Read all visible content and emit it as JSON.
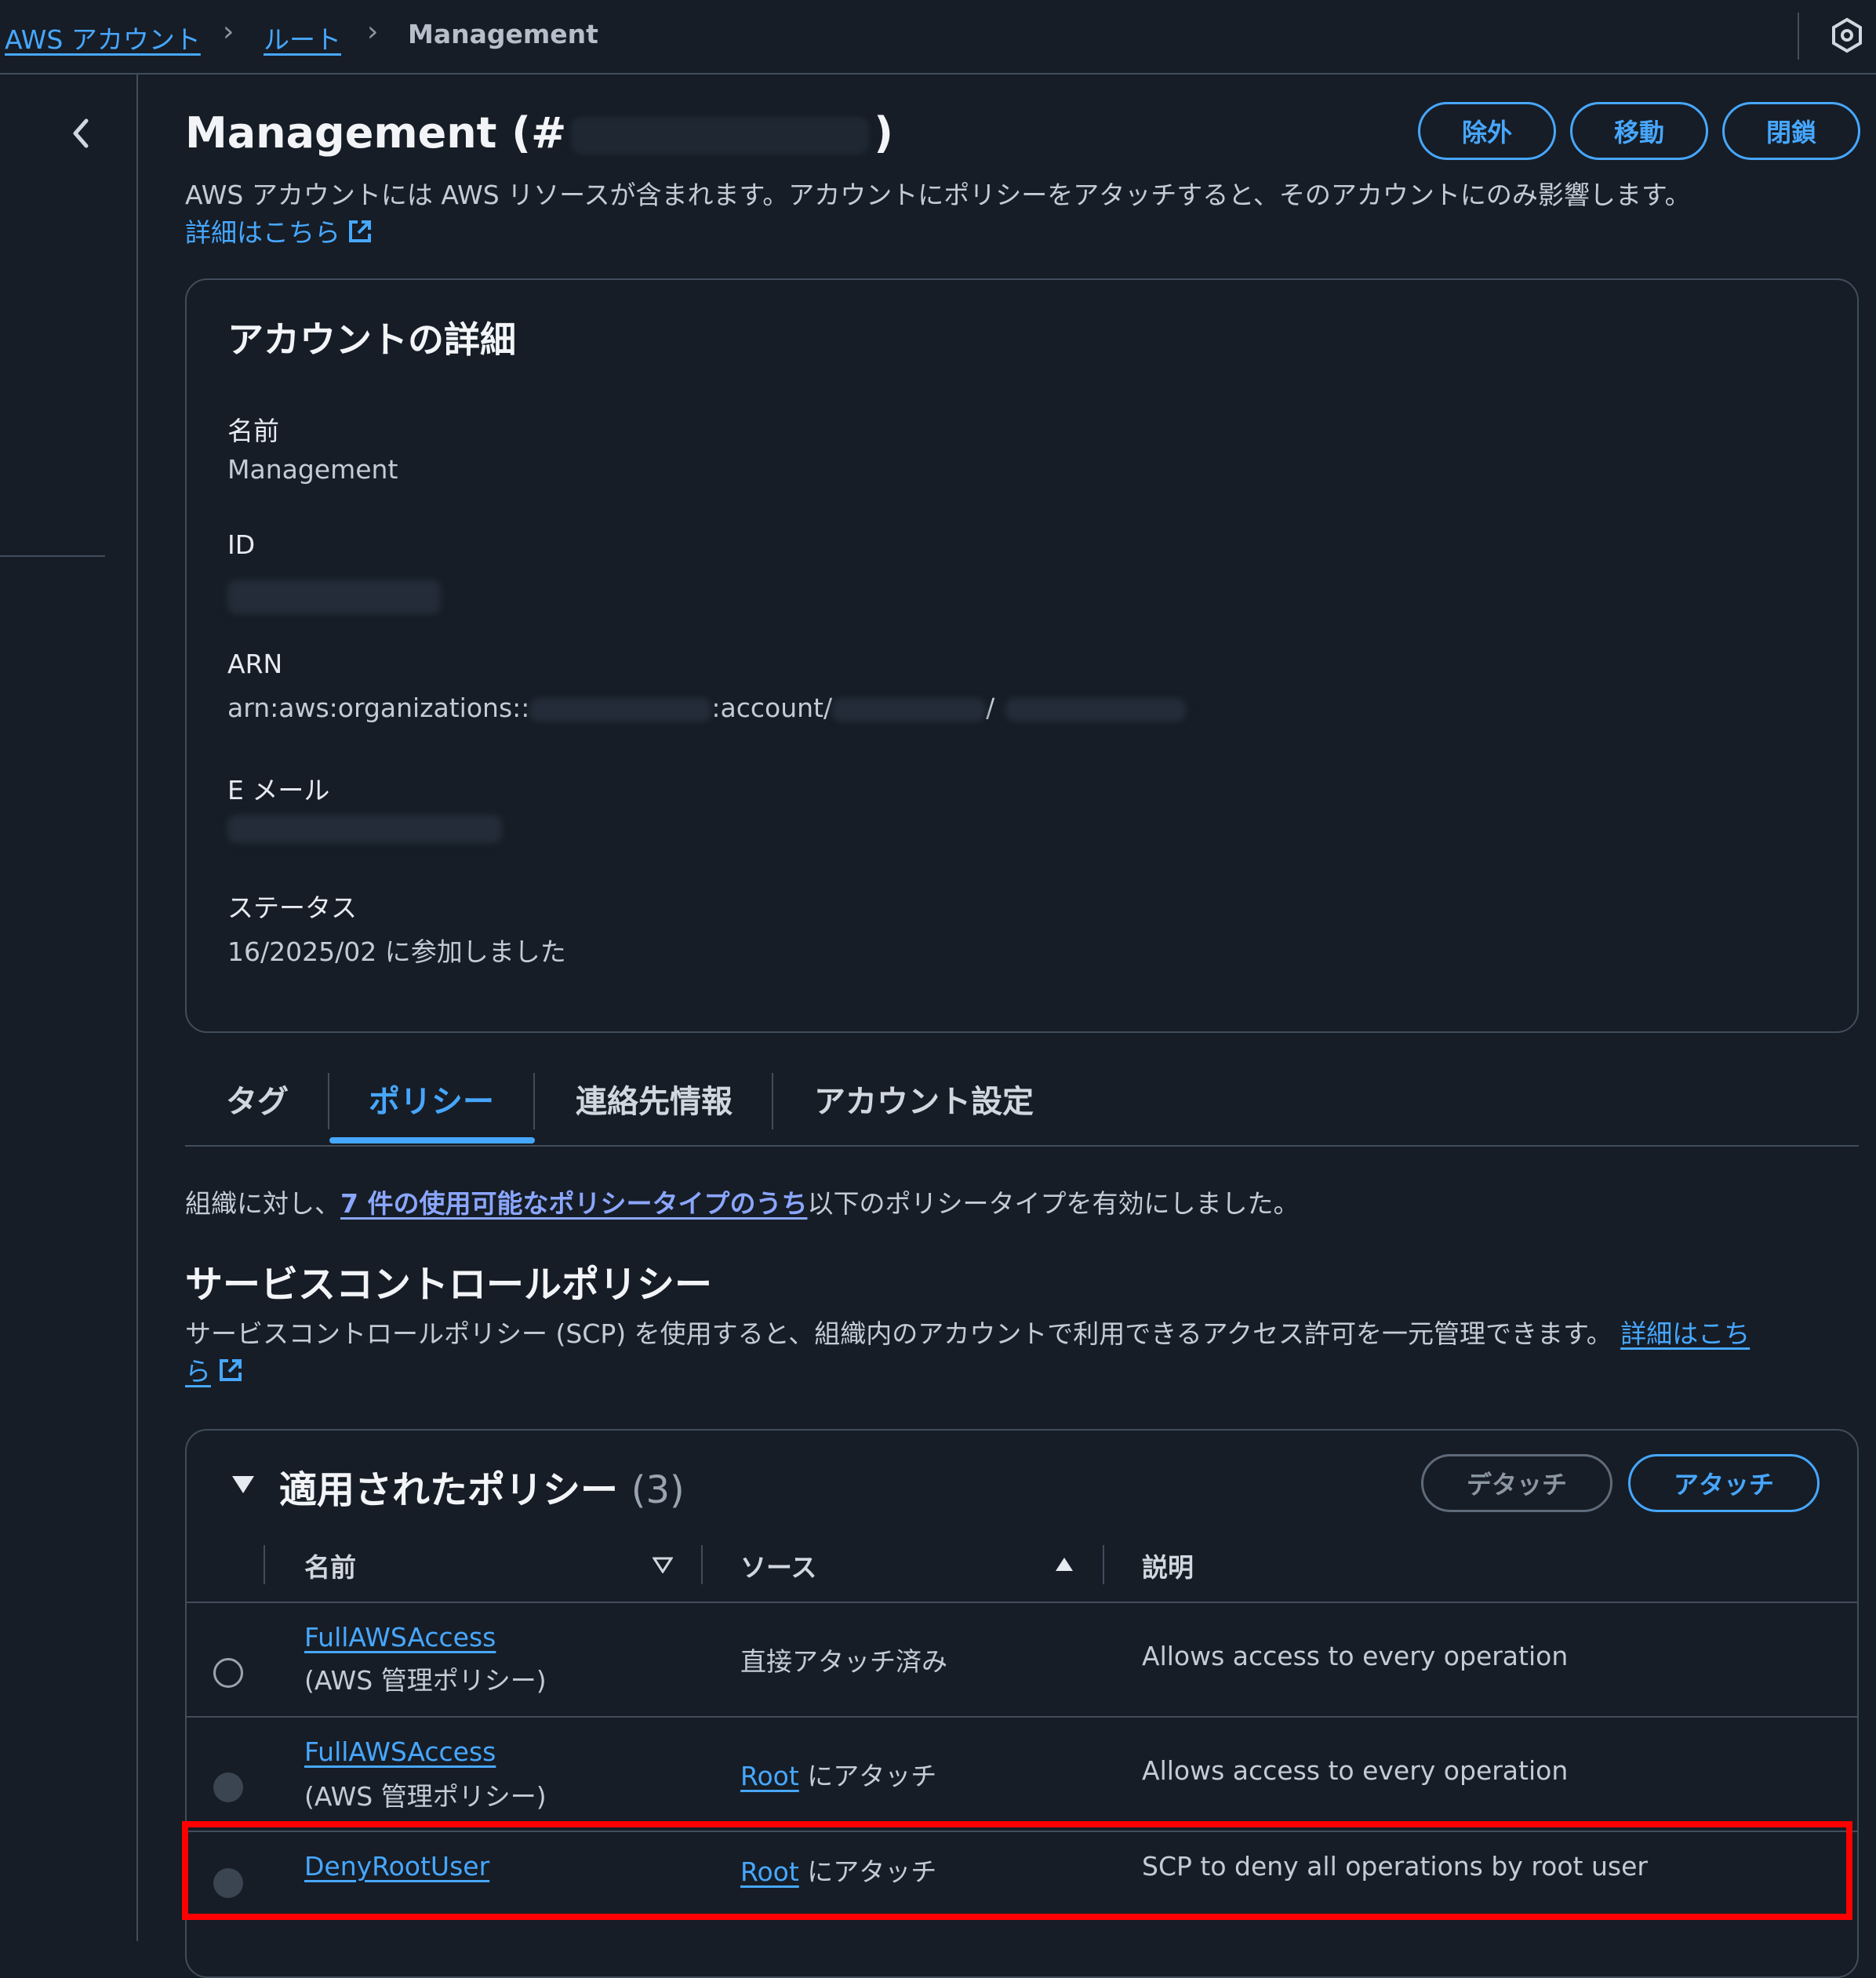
{
  "breadcrumb": {
    "items": [
      {
        "label": "AWS アカウント"
      },
      {
        "label": "ルート"
      },
      {
        "label": "Management"
      }
    ]
  },
  "header": {
    "title_prefix": "Management (#",
    "title_suffix": ")",
    "description": "AWS アカウントには AWS リソースが含まれます。アカウントにポリシーをアタッチすると、そのアカウントにのみ影響します。",
    "learn_more": "詳細はこちら",
    "buttons": {
      "remove": "除外",
      "move": "移動",
      "close": "閉鎖"
    }
  },
  "account_details": {
    "title": "アカウントの詳細",
    "name_label": "名前",
    "name_value": "Management",
    "id_label": "ID",
    "arn_label": "ARN",
    "arn_part1": "arn:aws:organizations::",
    "arn_part2": ":account/",
    "arn_part3": "/",
    "email_label": "E メール",
    "status_label": "ステータス",
    "status_value": "16/2025/02 に参加しました"
  },
  "tabs": [
    {
      "label": "タグ"
    },
    {
      "label": "ポリシー"
    },
    {
      "label": "連絡先情報"
    },
    {
      "label": "アカウント設定"
    }
  ],
  "policies_tab": {
    "intro_before": "組織に対し、",
    "intro_link": "7 件の使用可能なポリシータイプのうち",
    "intro_after": "以下のポリシータイプを有効にしました。",
    "scp_heading": "サービスコントロールポリシー",
    "scp_desc": "サービスコントロールポリシー (SCP) を使用すると、組織内のアカウントで利用できるアクセス許可を一元管理できます。",
    "scp_learn_1": "詳細はこち",
    "scp_learn_2": "ら",
    "applied_title": "適用されたポリシー",
    "applied_count": "(3)",
    "detach_label": "デタッチ",
    "attach_label": "アタッチ",
    "columns": {
      "name": "名前",
      "source": "ソース",
      "description": "説明"
    },
    "rows": [
      {
        "name": "FullAWSAccess",
        "type": "(AWS 管理ポリシー)",
        "source_link": "",
        "source_text": "直接アタッチ済み",
        "description": "Allows access to every operation"
      },
      {
        "name": "FullAWSAccess",
        "type": "(AWS 管理ポリシー)",
        "source_link": "Root",
        "source_text": "にアタッチ",
        "description": "Allows access to every operation"
      },
      {
        "name": "DenyRootUser",
        "type": "",
        "source_link": "Root",
        "source_text": "にアタッチ",
        "description": "SCP to deny all operations by root user"
      }
    ]
  },
  "colors": {
    "background": "#161d26",
    "accent": "#47a7ff",
    "highlight": "#ff0000"
  }
}
